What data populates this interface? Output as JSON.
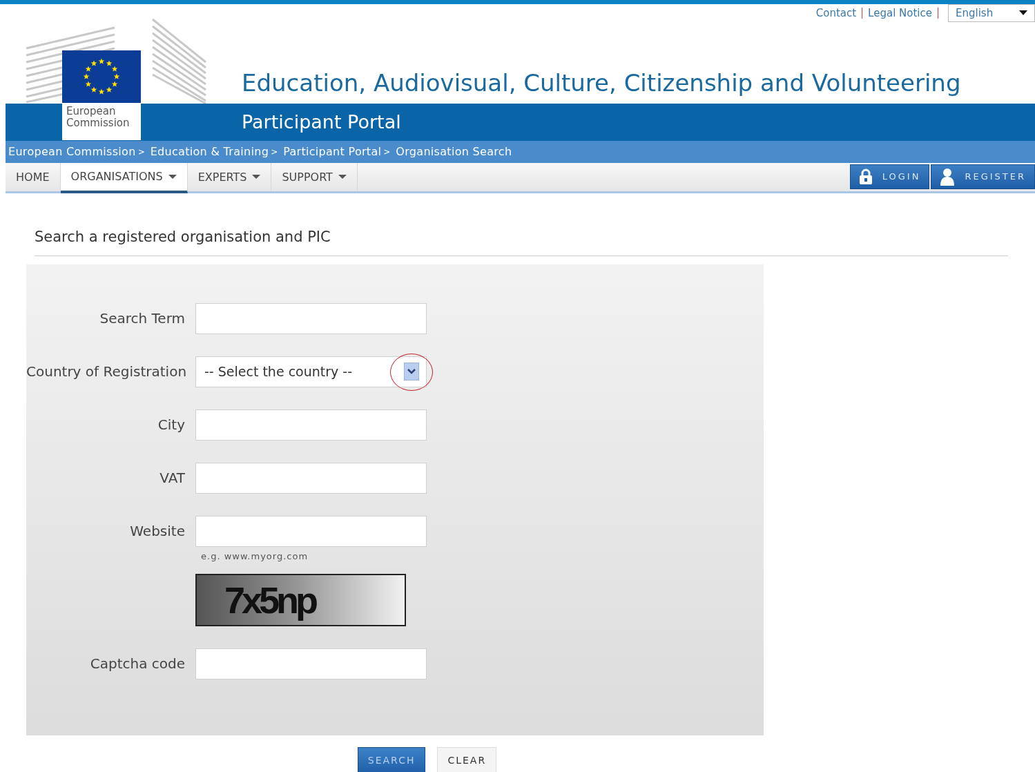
{
  "top_links": [
    {
      "label": "Contact"
    },
    {
      "label": "Legal Notice"
    }
  ],
  "language_select": {
    "value": "English"
  },
  "logo": {
    "lines": [
      "European",
      "Commission"
    ]
  },
  "site_title": "Education, Audiovisual, Culture, Citizenship and Volunteering",
  "portal_title": "Participant Portal",
  "breadcrumbs": [
    "European Commission",
    "Education & Training",
    "Participant Portal",
    "Organisation Search"
  ],
  "breadcrumb_separator": ">",
  "nav_tabs": [
    {
      "label": "HOME",
      "selected": false,
      "dropdown": false
    },
    {
      "label": "ORGANISATIONS",
      "selected": true,
      "dropdown": true
    },
    {
      "label": "EXPERTS",
      "selected": false,
      "dropdown": true
    },
    {
      "label": "SUPPORT",
      "selected": false,
      "dropdown": true
    }
  ],
  "auth_buttons": [
    {
      "kind": "login",
      "label": "LOGIN"
    },
    {
      "kind": "register",
      "label": "REGISTER"
    }
  ],
  "section_heading": "Search a registered organisation and PIC",
  "form_fields": [
    {
      "kind": "text",
      "label": "Search Term"
    },
    {
      "kind": "select",
      "label": "Country of Registration",
      "value": "-- Select the country --",
      "highlighted": true
    },
    {
      "kind": "text",
      "label": "City"
    },
    {
      "kind": "text",
      "label": "VAT"
    },
    {
      "kind": "text",
      "label": "Website",
      "hint": "e.g. www.myorg.com"
    },
    {
      "kind": "captcha",
      "text": "7x5np"
    },
    {
      "kind": "text",
      "label": "Captcha code"
    }
  ],
  "buttons": [
    {
      "kind": "primary",
      "label": "SEARCH"
    },
    {
      "kind": "secondary",
      "label": "CLEAR"
    }
  ]
}
